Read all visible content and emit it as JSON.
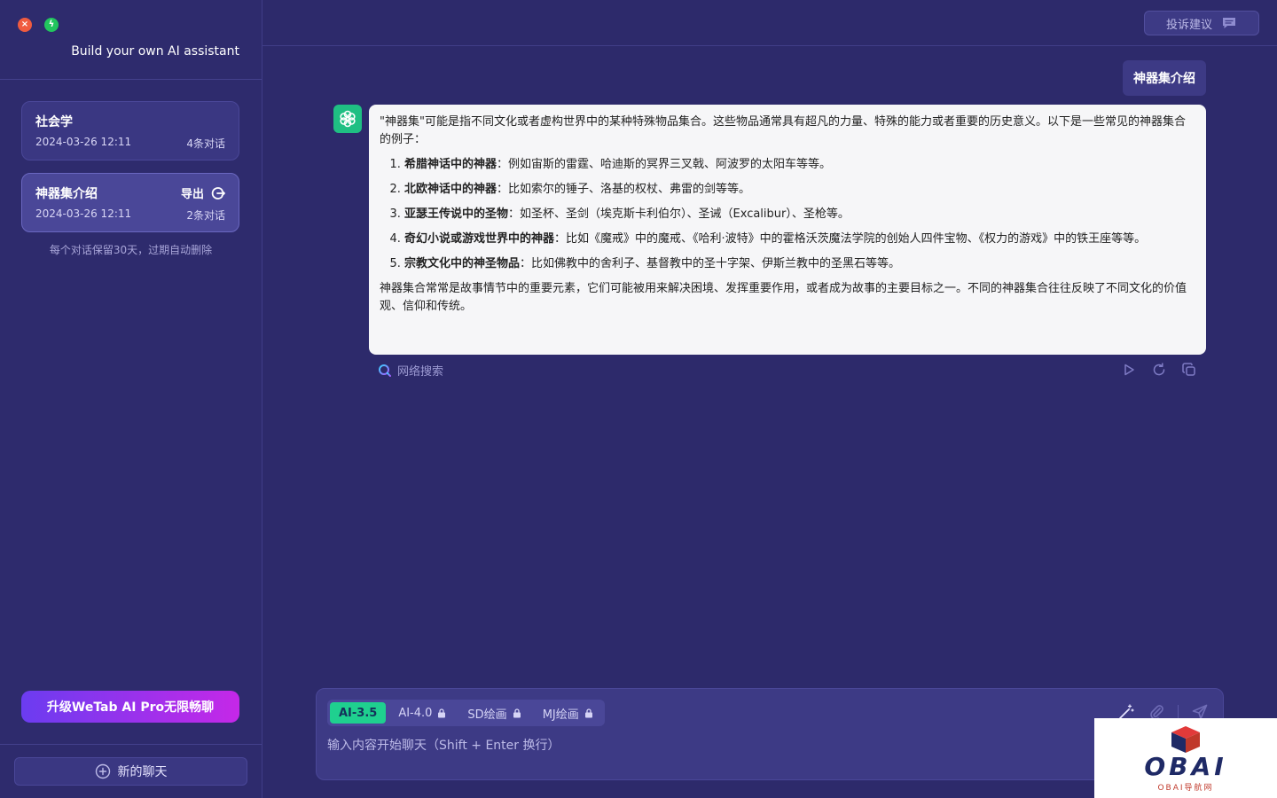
{
  "window": {
    "tagline": "Build your own AI assistant"
  },
  "sidebar": {
    "conversations": [
      {
        "title": "社会学",
        "date": "2024-03-26 12:11",
        "count": "4条对话"
      },
      {
        "title": "神器集介绍",
        "date": "2024-03-26 12:11",
        "count": "2条对话",
        "export_label": "导出"
      }
    ],
    "retention_note": "每个对话保留30天，过期自动删除",
    "upgrade_label": "升级WeTab AI Pro无限畅聊",
    "new_chat_label": "新的聊天"
  },
  "header": {
    "feedback_label": "投诉建议"
  },
  "chat": {
    "user_message": "神器集介绍",
    "bot_intro": "\"神器集\"可能是指不同文化或者虚构世界中的某种特殊物品集合。这些物品通常具有超凡的力量、特殊的能力或者重要的历史意义。以下是一些常见的神器集合的例子：",
    "bot_items": [
      {
        "bold": "希腊神话中的神器",
        "text": "：例如宙斯的雷霆、哈迪斯的冥界三叉戟、阿波罗的太阳车等等。"
      },
      {
        "bold": "北欧神话中的神器",
        "text": "：比如索尔的锤子、洛基的权杖、弗雷的剑等等。"
      },
      {
        "bold": "亚瑟王传说中的圣物",
        "text": "：如圣杯、圣剑（埃克斯卡利伯尔）、圣诫（Excalibur）、圣枪等。"
      },
      {
        "bold": "奇幻小说或游戏世界中的神器",
        "text": "：比如《魔戒》中的魔戒、《哈利·波特》中的霍格沃茨魔法学院的创始人四件宝物、《权力的游戏》中的铁王座等等。"
      },
      {
        "bold": "宗教文化中的神圣物品",
        "text": "：比如佛教中的舍利子、基督教中的圣十字架、伊斯兰教中的圣黑石等等。"
      }
    ],
    "bot_outro": "神器集合常常是故事情节中的重要元素，它们可能被用来解决困境、发挥重要作用，或者成为故事的主要目标之一。不同的神器集合往往反映了不同文化的价值观、信仰和传统。",
    "web_search_label": "网络搜索"
  },
  "composer": {
    "models": [
      {
        "label": "AI-3.5",
        "locked": false
      },
      {
        "label": "AI-4.0",
        "locked": true
      },
      {
        "label": "SD绘画",
        "locked": true
      },
      {
        "label": "MJ绘画",
        "locked": true
      }
    ],
    "placeholder": "输入内容开始聊天（Shift + Enter 换行）"
  },
  "watermark": {
    "text": "OBAI",
    "subtext": "OBAI导航网"
  },
  "colors": {
    "background": "#2d2a6b",
    "accent_green": "#1fd08f",
    "upgrade_gradient_start": "#6b3cf0",
    "upgrade_gradient_end": "#c528e8"
  }
}
